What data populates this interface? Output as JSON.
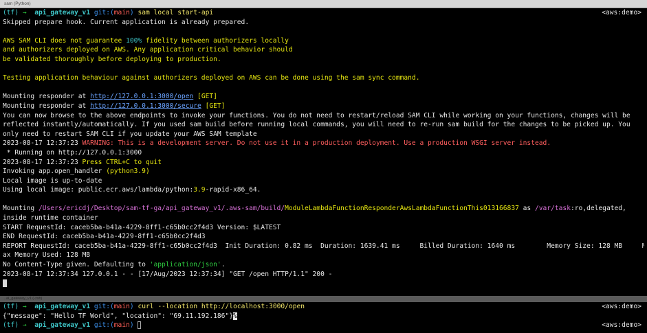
{
  "window": {
    "title": "sam (Python)"
  },
  "pane1": {
    "prompt": {
      "env": "(tf)",
      "arrow": "→",
      "dir": "api_gateway_v1",
      "git_prefix": "git:(",
      "branch": "main",
      "git_suffix": ")",
      "command": "sam local start-api",
      "right": "<aws:demo>"
    },
    "l_skip": "Skipped prepare hook. Current application is already prepared.",
    "warn1_a": "AWS SAM CLI does not guarantee ",
    "warn1_b": "100%",
    "warn1_c": " fidelity between authorizers locally",
    "warn2": "and authorizers deployed on AWS. Any application critical behavior should",
    "warn3": "be validated thoroughly before deploying to production.",
    "testing": "Testing application behaviour against authorizers deployed on AWS can be done using the sam sync command.",
    "mount1_a": "Mounting responder at ",
    "mount1_url": "http://127.0.0.1:3000/open",
    "mount1_b": " [GET]",
    "mount2_a": "Mounting responder at ",
    "mount2_url": "http://127.0.0.1:3000/secure",
    "mount2_b": " [GET]",
    "browse1": "You can now browse to the above endpoints to invoke your functions. You do not need to restart/reload SAM CLI while working on your functions, changes will be",
    "browse2": "reflected instantly/automatically. If you used sam build before running local commands, you will need to re-run sam build for the changes to be picked up. You",
    "browse3": "only need to restart SAM CLI if you update your AWS SAM template",
    "warnline_a": "2023-08-17 12:37:23 ",
    "warnline_b": "WARNING: This is a development server. Do not use it in a production deployment. Use a production WSGI server instead.",
    "running": " * Running on http://127.0.0.1:3000",
    "quit_a": "2023-08-17 12:37:23 ",
    "quit_b": "Press CTRL+C to quit",
    "invoking_a": "Invoking app.open_handler ",
    "invoking_b": "(python3.9)",
    "local_img": "Local image is up-to-date",
    "using_a": "Using local image: public.ecr.aws/lambda/python:",
    "using_b": "3.9",
    "using_c": "-rapid-x86_64.",
    "mounting_a": "Mounting ",
    "mounting_path": "/Users/ericdj/Desktop/sam-tf-ga/api_gateway_v1/.aws-sam/build/",
    "mounting_fn": "ModuleLambdaFunctionResponderAwsLambdaFunctionThis013166837",
    "mounting_as": " as ",
    "mounting_var": "/var/task",
    "mounting_c": ":ro,delegated,",
    "inside": "inside runtime container",
    "start": "START RequestId: caceb5ba-b41a-4229-8ff1-c65b0cc2f4d3 Version: $LATEST",
    "end": "END RequestId: caceb5ba-b41a-4229-8ff1-c65b0cc2f4d3",
    "report": "REPORT RequestId: caceb5ba-b41a-4229-8ff1-c65b0cc2f4d3  Init Duration: 0.82 ms  Duration: 1639.41 ms     Billed Duration: 1640 ms        Memory Size: 128 MB     M",
    "maxmem": "ax Memory Used: 128 MB",
    "content_a": "No Content-Type given. Defaulting to ",
    "content_b": "'application/json'",
    "content_c": ".",
    "access": "2023-08-17 12:37:34 127.0.0.1 - - [17/Aug/2023 12:37:34] \"GET /open HTTP/1.1\" 200 -"
  },
  "pane2": {
    "title": "..ai_gateway_v1 (-zsh)",
    "prompt": {
      "env": "(tf)",
      "arrow": "→",
      "dir": "api_gateway_v1",
      "git_prefix": "git:(",
      "branch": "main",
      "git_suffix": ")",
      "command": "curl --location http://localhost:3000/open",
      "right": "<aws:demo>"
    },
    "output": "{\"message\": \"Hello TF World\", \"location\": \"69.11.192.186\"}",
    "output_mark": "%",
    "prompt2": {
      "env": "(tf)",
      "arrow": "→",
      "dir": "api_gateway_v1",
      "git_prefix": "git:(",
      "branch": "main",
      "git_suffix": ")",
      "right": "<aws:demo>"
    }
  }
}
